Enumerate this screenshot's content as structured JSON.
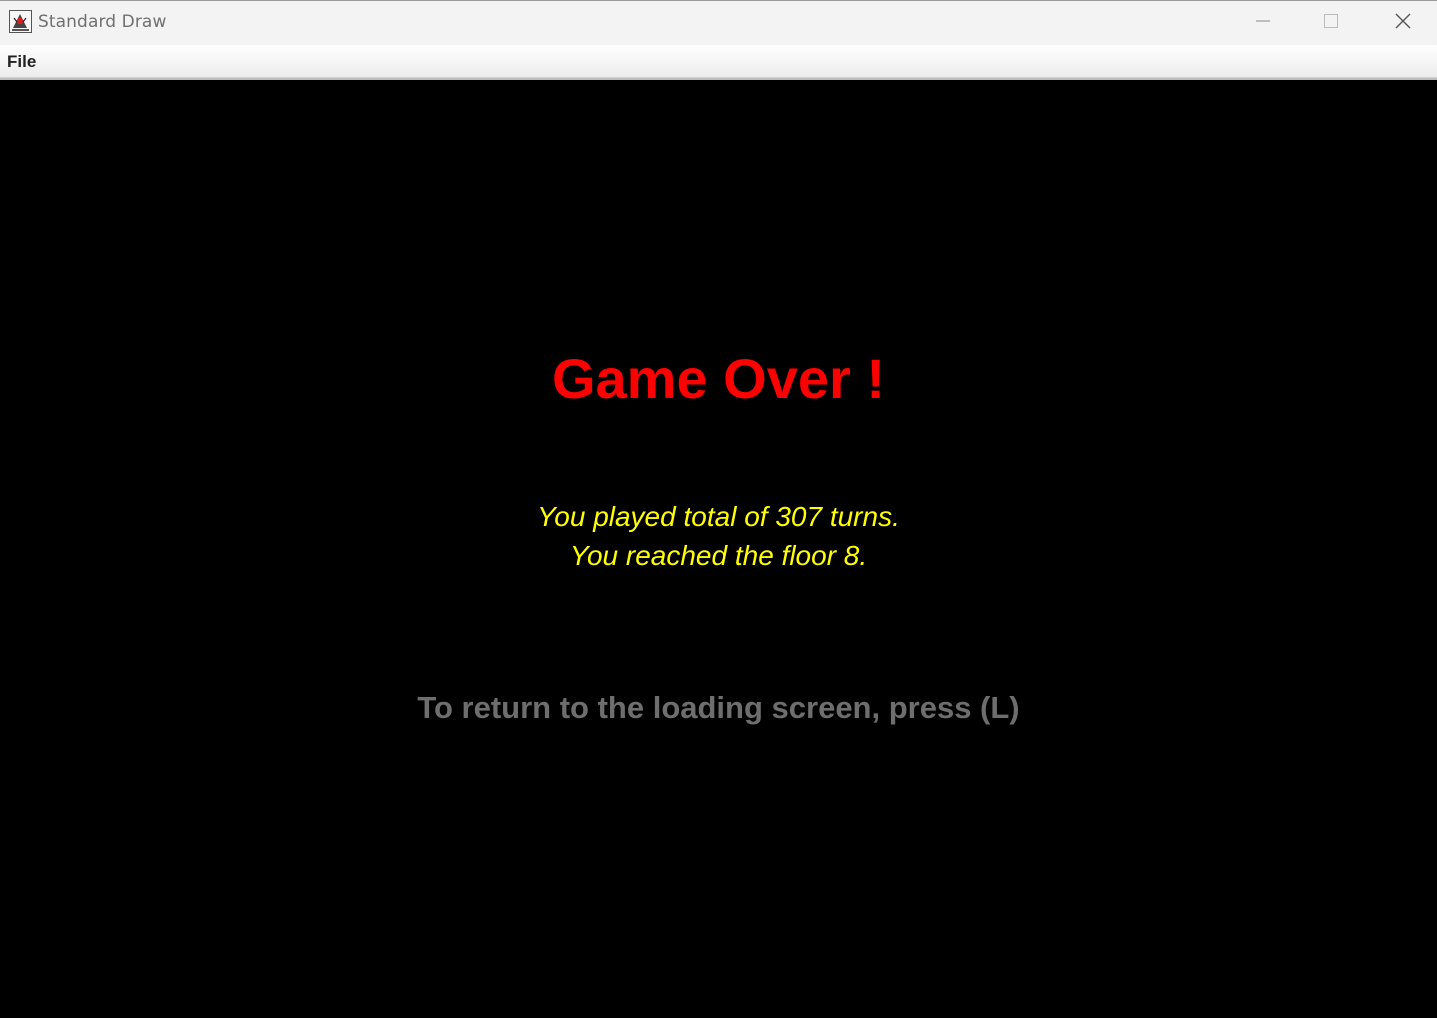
{
  "window": {
    "title": "Standard Draw",
    "icon": "java-duke-icon"
  },
  "controls": {
    "minimize_icon": "minimize-icon",
    "maximize_icon": "maximize-icon",
    "close_icon": "close-icon"
  },
  "menubar": {
    "file_label": "File"
  },
  "game": {
    "heading": "Game Over !",
    "turns_line": "You played total of 307 turns.",
    "floor_line": "You reached the floor 8.",
    "return_hint": "To return to the loading screen, press (L)",
    "colors": {
      "background": "#000000",
      "heading": "#ff0000",
      "stats": "#ffff00",
      "hint": "#6e6e6e"
    }
  }
}
